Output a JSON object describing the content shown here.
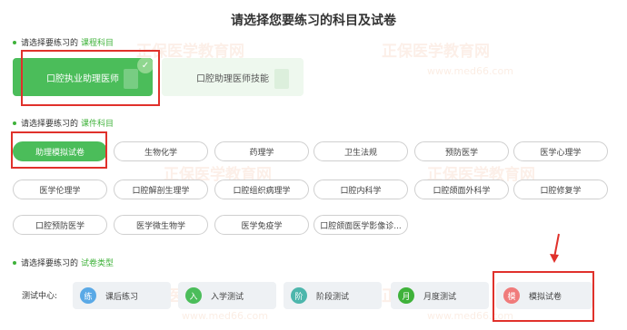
{
  "title": "请选择您要练习的科目及试卷",
  "course_section": {
    "prefix": "请选择要练习的",
    "highlight": "课程科目"
  },
  "courses": [
    {
      "label": "口腔执业助理医师",
      "selected": true
    },
    {
      "label": "口腔助理医师技能",
      "selected": false
    }
  ],
  "subject_section": {
    "prefix": "请选择要练习的",
    "highlight": "课件科目"
  },
  "subjects": [
    "助理模拟试卷",
    "生物化学",
    "药理学",
    "卫生法规",
    "预防医学",
    "医学心理学",
    "医学伦理学",
    "口腔解剖生理学",
    "口腔组织病理学",
    "口腔内科学",
    "口腔颌面外科学",
    "口腔修复学",
    "口腔预防医学",
    "医学微生物学",
    "医学免疫学",
    "口腔颌面医学影像诊..."
  ],
  "type_section": {
    "prefix": "请选择要练习的",
    "highlight": "试卷类型"
  },
  "test_center_label": "测试中心:",
  "test_types": [
    {
      "badge": "练",
      "label": "课后练习",
      "color": "#5aa9e6"
    },
    {
      "badge": "入",
      "label": "入学测试",
      "color": "#4bbd5a"
    },
    {
      "badge": "阶",
      "label": "阶段测试",
      "color": "#4db6ac"
    },
    {
      "badge": "月",
      "label": "月度测试",
      "color": "#3fb23a"
    },
    {
      "badge": "模",
      "label": "模拟试卷",
      "color": "#f07b7b"
    }
  ],
  "watermark": {
    "text": "正保医学教育网",
    "url": "www.med66.com"
  },
  "colors": {
    "accent": "#3fb23a",
    "annotation": "#e0312b"
  }
}
